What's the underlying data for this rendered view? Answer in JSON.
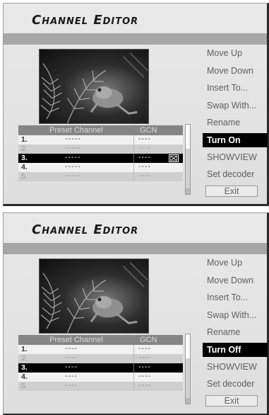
{
  "panels": [
    {
      "title": "Channel Editor",
      "menu": [
        "Move Up",
        "Move Down",
        "Insert To...",
        "Swap With...",
        "Rename",
        "Turn On",
        "SHOWVIEW",
        "Set decoder",
        "Exit"
      ],
      "selected_menu_index": 5,
      "table": {
        "headers": [
          "Preset Channel",
          "GCN"
        ],
        "rows": [
          {
            "num": "1.",
            "channel": "-----",
            "gcn": "----"
          },
          {
            "num": "2.",
            "channel": "-----",
            "gcn": "----"
          },
          {
            "num": "3.",
            "channel": "-----",
            "gcn": "----",
            "timer_icon": "skip-icon"
          },
          {
            "num": "4.",
            "channel": "-----",
            "gcn": "----"
          },
          {
            "num": "5.",
            "channel": "-----",
            "gcn": "----"
          }
        ],
        "selected_row_index": 2
      }
    },
    {
      "title": "Channel Editor",
      "menu": [
        "Move Up",
        "Move Down",
        "Insert To...",
        "Swap With...",
        "Rename",
        "Turn Off",
        "SHOWVIEW",
        "Set decoder",
        "Exit"
      ],
      "selected_menu_index": 5,
      "table": {
        "headers": [
          "Preset Channel",
          "GCN"
        ],
        "rows": [
          {
            "num": "1.",
            "channel": "----",
            "gcn": "----"
          },
          {
            "num": "2.",
            "channel": "----",
            "gcn": "----"
          },
          {
            "num": "3.",
            "channel": "----",
            "gcn": "----"
          },
          {
            "num": "4.",
            "channel": "----",
            "gcn": "----"
          },
          {
            "num": "5.",
            "channel": "----",
            "gcn": "----"
          }
        ],
        "selected_row_index": 2
      }
    }
  ],
  "colors": {
    "selected_bg": "#000000",
    "panel_bg": "#e5e5e5",
    "title_bar": "#a7a7a7",
    "menu_text": "#5f5f5f"
  }
}
